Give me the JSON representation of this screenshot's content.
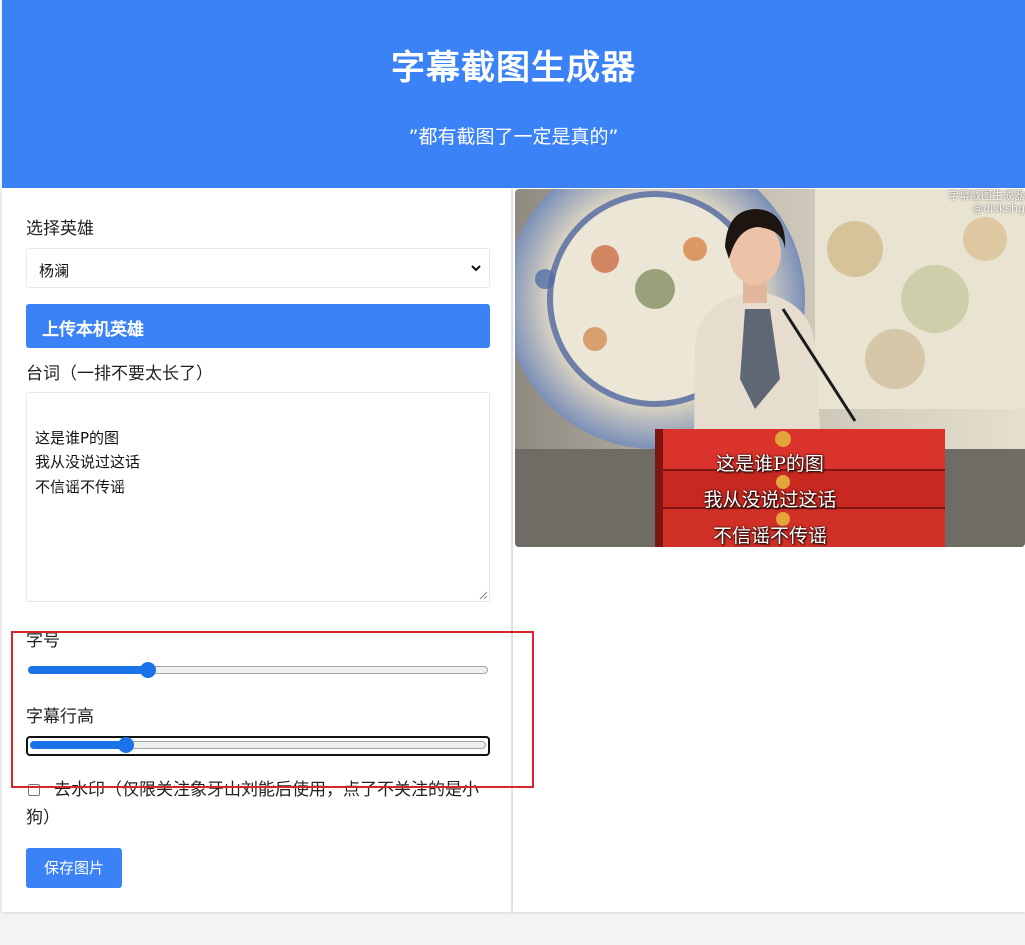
{
  "header": {
    "title": "字幕截图生成器",
    "subtitle": "”都有截图了一定是真的”"
  },
  "form": {
    "hero_label": "选择英雄",
    "hero_selected": "杨澜",
    "upload_label": "上传本机英雄",
    "lines_label": "台词（一排不要太长了）",
    "lines_text": "这是谁P的图\n我从没说过这话\n不信谣不传谣",
    "font_size_label": "字号",
    "font_size_value": 0.26,
    "line_height_label": "字幕行高",
    "line_height_value": 0.21,
    "watermark_label": "去水印（仅限关注象牙山刘能后使用，点了不关注的是小狗）",
    "watermark_checked": false,
    "save_label": "保存图片"
  },
  "preview": {
    "subtitle_lines": [
      "这是谁P的图",
      "我从没说过这话",
      "不信谣不传谣"
    ],
    "watermark_lines": [
      "字幕截图生成器",
      "@diskshg"
    ]
  },
  "colors": {
    "header_bg": "#3b82f6",
    "accent": "#3b82f6",
    "slider_blue": "#1a73e8",
    "highlight_red": "#d7262b"
  }
}
